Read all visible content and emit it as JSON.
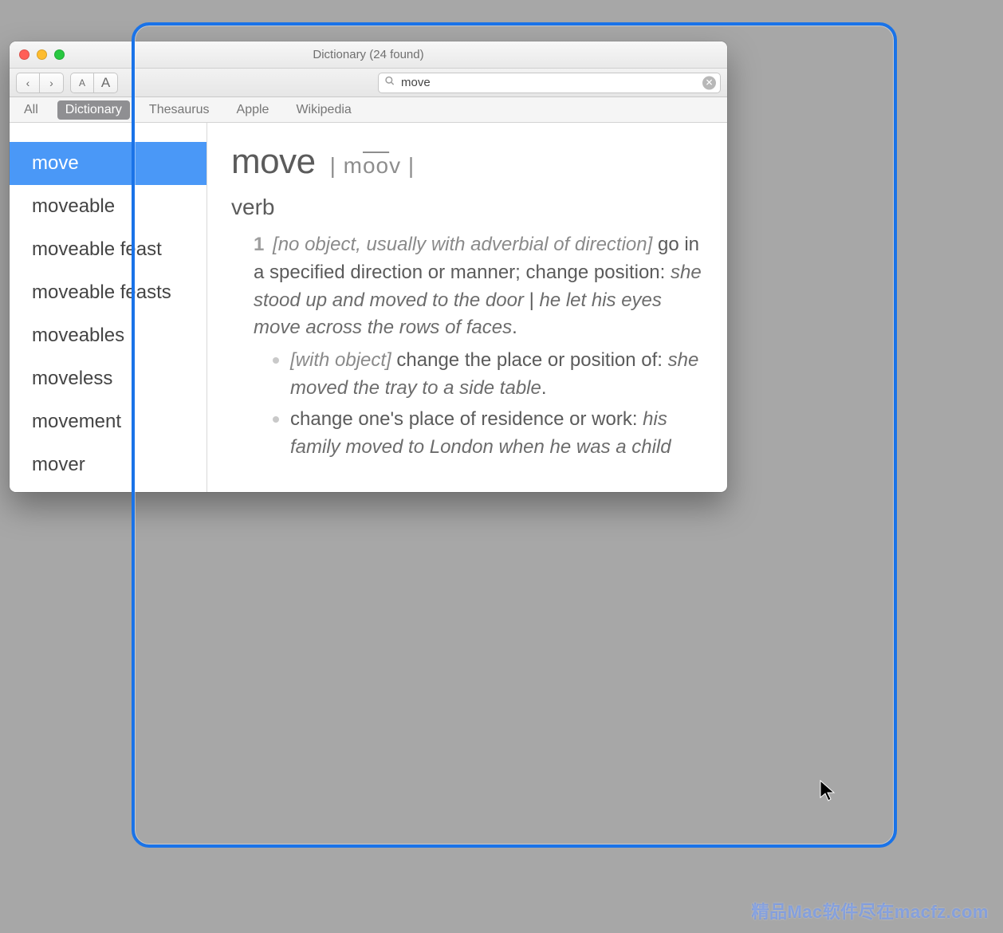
{
  "window": {
    "title": "Dictionary (24 found)"
  },
  "toolbar": {
    "back_glyph": "‹",
    "forward_glyph": "›",
    "font_small": "A",
    "font_large": "A"
  },
  "search": {
    "value": "move",
    "clear_glyph": "✕"
  },
  "tabs": {
    "items": [
      {
        "label": "All",
        "selected": false
      },
      {
        "label": "Dictionary",
        "selected": true
      },
      {
        "label": "Thesaurus",
        "selected": false
      },
      {
        "label": "Apple",
        "selected": false
      },
      {
        "label": "Wikipedia",
        "selected": false
      }
    ]
  },
  "sidebar": {
    "items": [
      {
        "label": "move",
        "selected": true
      },
      {
        "label": "moveable",
        "selected": false
      },
      {
        "label": "moveable feast",
        "selected": false
      },
      {
        "label": "moveable feasts",
        "selected": false
      },
      {
        "label": "moveables",
        "selected": false
      },
      {
        "label": "moveless",
        "selected": false
      },
      {
        "label": "movement",
        "selected": false
      },
      {
        "label": "mover",
        "selected": false
      }
    ]
  },
  "entry": {
    "headword": "move",
    "pron_pre": "| m",
    "pron_macron": "oo",
    "pron_post": "v |",
    "pos": "verb",
    "sense1": {
      "num": "1",
      "grammar": "[no object, usually with adverbial of direction]",
      "def": " go in a specified direction or manner; change position: ",
      "ex1": "she stood up and moved to the door",
      "sep": " | ",
      "ex2": "he let his eyes move across the rows of faces",
      "period": ".",
      "sub1_gram": "[with object]",
      "sub1_def": " change the place or position of: ",
      "sub1_ex": "she moved the tray to a side table",
      "sub1_period": ".",
      "sub2_def": "change one's place of residence or work: ",
      "sub2_ex": "his family moved to London when he was a child"
    }
  },
  "watermark": "精品Mac软件尽在macfz.com"
}
